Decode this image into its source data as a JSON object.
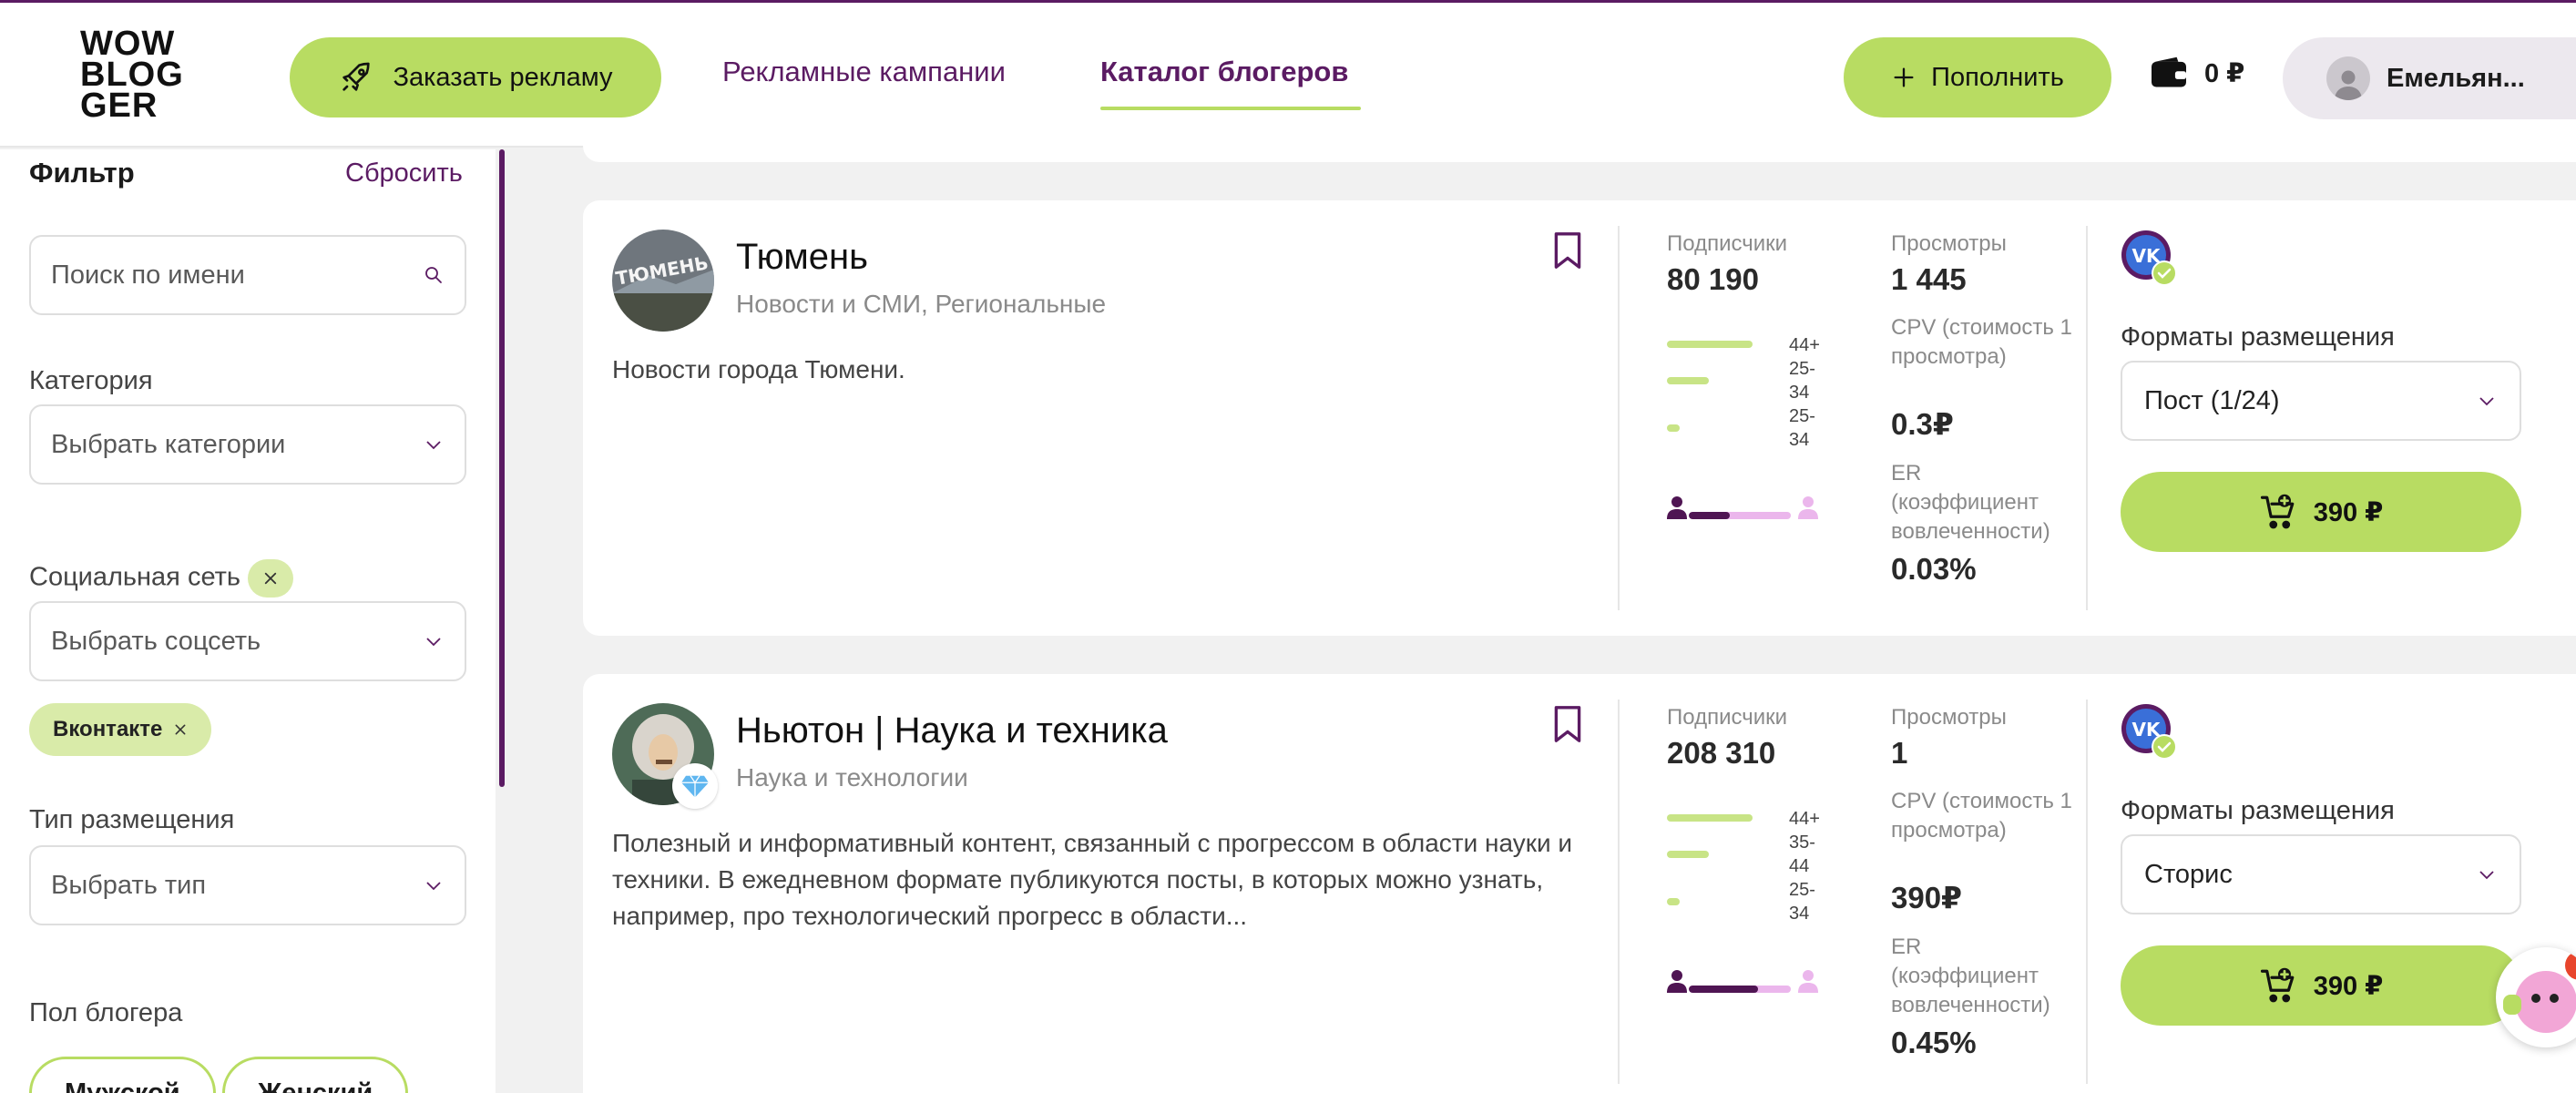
{
  "header": {
    "logo_lines": [
      "WOW",
      "BLOG",
      "GER"
    ],
    "order_ad_label": "Заказать рекламу",
    "nav": {
      "campaigns": "Рекламные кампании",
      "catalog": "Каталог блогеров"
    },
    "topup_label": "Пополнить",
    "balance": "0 ₽",
    "user_name": "Емельян..."
  },
  "sidebar": {
    "title": "Фильтр",
    "reset": "Сбросить",
    "search_placeholder": "Поиск по имени",
    "category": {
      "label": "Категория",
      "placeholder": "Выбрать категории"
    },
    "social": {
      "label": "Социальная сеть",
      "placeholder": "Выбрать соцсеть",
      "selected_tag": "Вконтакте"
    },
    "placement": {
      "label": "Тип размещения",
      "placeholder": "Выбрать тип"
    },
    "gender": {
      "label": "Пол блогера",
      "options": [
        "Мужской",
        "Женский"
      ]
    }
  },
  "colors": {
    "accent_purple": "#5b1b63",
    "lime": "#b8dc62",
    "female_pink": "#ebb6ec"
  },
  "cards": [
    {
      "name": "Тюмень",
      "avatar_text": "ТЮМЕНЬ",
      "categories": "Новости и СМИ,  Региональные",
      "description": "Новости города Тюмени.",
      "subscribers_label": "Подписчики",
      "subscribers": "80 190",
      "views_label": "Просмотры",
      "views": "1 445",
      "cpv_label": "CPV (стоимость 1 просмотра)",
      "cpv": "0.3₽",
      "er_label": "ER (коэффициент вовлеченности)",
      "er": "0.03%",
      "age_groups": [
        {
          "label": "44+",
          "share": 0.78
        },
        {
          "label": "25-34",
          "share": 0.38
        },
        {
          "label": "25-34",
          "share": 0.12
        }
      ],
      "male_share": 0.4,
      "network_icon": "vk-icon",
      "formats_label": "Форматы размещения",
      "format": "Пост (1/24)",
      "price": "390 ₽"
    },
    {
      "name": "Ньютон | Наука и техника",
      "categories": "Наука и технологии",
      "description": "Полезный и информативный контент, связанный с прогрессом в области науки и техники. В ежедневном формате публикуются посты, в которых можно узнать, например, про технологический прогресс в области...",
      "subscribers_label": "Подписчики",
      "subscribers": "208 310",
      "views_label": "Просмотры",
      "views": "1",
      "cpv_label": "CPV (стоимость 1 просмотра)",
      "cpv": "390₽",
      "er_label": "ER (коэффициент вовлеченности)",
      "er": "0.45%",
      "age_groups": [
        {
          "label": "44+",
          "share": 0.78
        },
        {
          "label": "35-44",
          "share": 0.38
        },
        {
          "label": "25-34",
          "share": 0.12
        }
      ],
      "male_share": 0.68,
      "network_icon": "vk-icon",
      "formats_label": "Форматы размещения",
      "format": "Сторис",
      "price": "390 ₽"
    }
  ]
}
